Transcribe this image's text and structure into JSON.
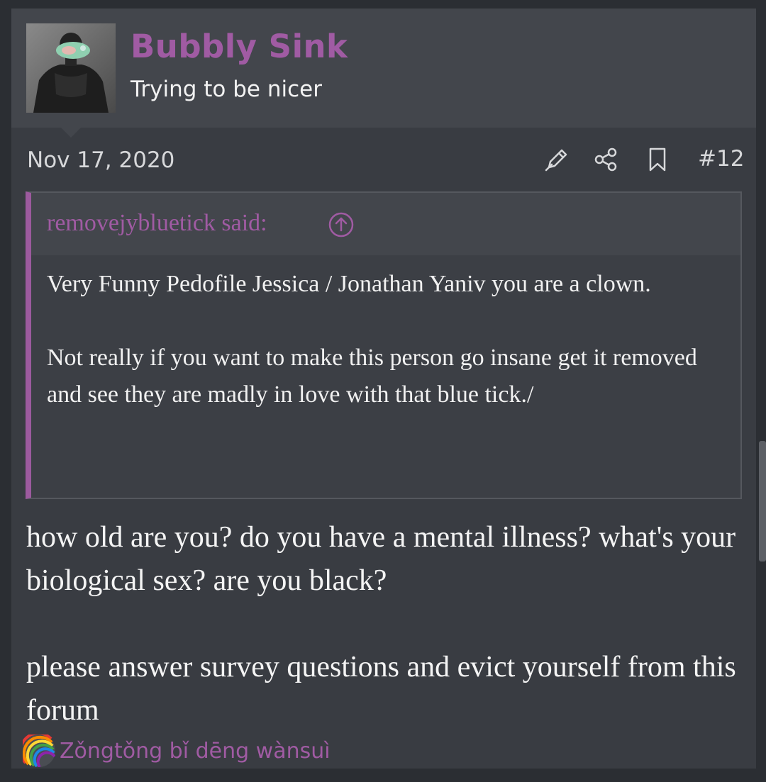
{
  "post": {
    "author": {
      "name": "Bubbly Sink",
      "title": "Trying to be nicer",
      "avatar_icon": "avatar-photo"
    },
    "date": "Nov 17, 2020",
    "number": "#12",
    "actions": [
      "edit-icon",
      "share-icon",
      "bookmark-icon"
    ],
    "quote": {
      "author_label": "removejybluetick said:",
      "paragraphs": [
        "Very Funny Pedofile Jessica / Jonathan Yaniv you are a clown.",
        "Not really if you want to make this person go insane get it removed and see they are madly in love with that blue tick./"
      ]
    },
    "body": {
      "paragraphs": [
        "how old are you? do you have a mental illness? what's your biological sex? are you black?",
        "please answer survey questions and evict yourself from this forum"
      ]
    },
    "signature": {
      "icon": "rainbow-icon",
      "text": "Zǒngtǒng bǐ dēng wànsuì"
    }
  },
  "colors": {
    "accent": "#a05ba3",
    "background": "#393c42",
    "header": "#43464c"
  }
}
